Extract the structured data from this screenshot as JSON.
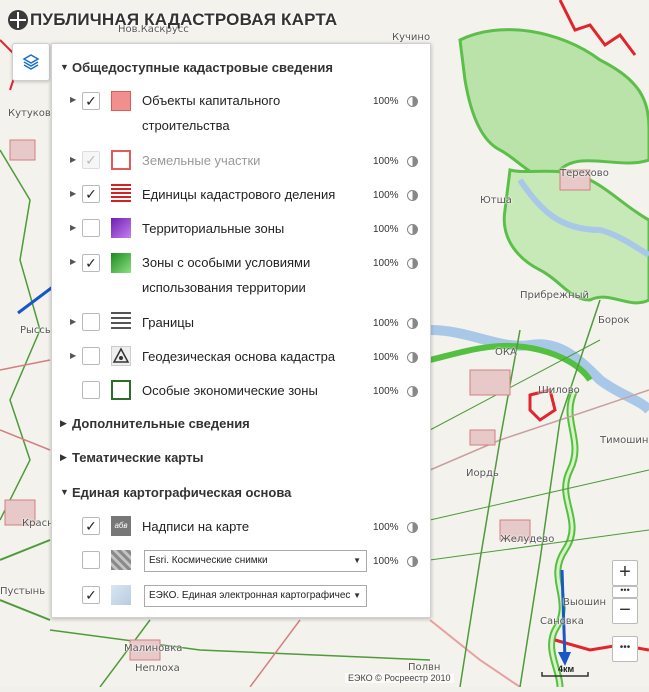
{
  "app": {
    "title": "ПУБЛИЧНАЯ КАДАСТРОВАЯ КАРТА"
  },
  "map": {
    "labels": [
      "Нов.Каскрусс",
      "Кучино",
      "Кутуково",
      "Терехово",
      "Ютша",
      "Прибрежный",
      "Борок",
      "ОКА",
      "Шилово",
      "Тимошин",
      "Рыссы",
      "Иордь",
      "Желудево",
      "Красн",
      "Пустынь",
      "Сановка",
      "Малиновка",
      "Неплоха",
      "Полвн",
      "Выошин"
    ],
    "copyright": "ЕЭКО © Росреестр 2010",
    "scale_label": "4км"
  },
  "panel": {
    "public_section": {
      "title": "Общедоступные кадастровые сведения",
      "layers": [
        {
          "label": "Объекты капитального строительства",
          "opacity": "100%",
          "checked": true,
          "disabled": false,
          "swatch": "#f18e8e"
        },
        {
          "label": "Земельные участки",
          "opacity": "100%",
          "checked": true,
          "disabled": true,
          "swatch": "#e45a5a"
        },
        {
          "label": "Единицы кадастрового деления",
          "opacity": "100%",
          "checked": true,
          "disabled": false,
          "swatch": "#d42020"
        },
        {
          "label": "Территориальные зоны",
          "opacity": "100%",
          "checked": false,
          "disabled": false,
          "swatch": "#9b42d6"
        },
        {
          "label": "Зоны с особыми условиями использования территории",
          "opacity": "100%",
          "checked": true,
          "disabled": false,
          "swatch": "#2aa632"
        },
        {
          "label": "Границы",
          "opacity": "100%",
          "checked": false,
          "disabled": false,
          "swatch": "#555555"
        },
        {
          "label": "Геодезическая основа кадастра",
          "opacity": "100%",
          "checked": false,
          "disabled": false,
          "swatch": "#333333"
        },
        {
          "label": "Особые экономические зоны",
          "opacity": "100%",
          "checked": false,
          "disabled": false,
          "swatch": "#2a6e2a"
        }
      ]
    },
    "additional_section": {
      "title": "Дополнительные сведения"
    },
    "thematic_section": {
      "title": "Тематические карты"
    },
    "base_section": {
      "title": "Единая картографическая основа",
      "labels_layer": {
        "label": "Надписи на карте",
        "opacity": "100%",
        "checked": true,
        "icon_text": "абв"
      },
      "satellite_layer": {
        "select_value": "Esri. Космические снимки",
        "opacity": "100%",
        "checked": false
      },
      "eeko_layer": {
        "select_value": "ЕЭКО. Единая электронная картографичес",
        "checked": true
      }
    }
  },
  "colors": {
    "cadastral_red": "#e0252c",
    "zone_green": "#3aa83a",
    "accent_blue": "#1a56c8"
  }
}
